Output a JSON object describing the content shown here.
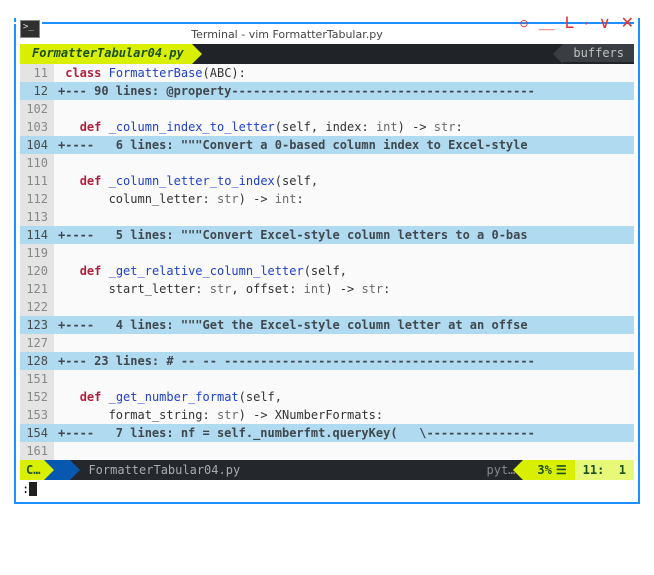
{
  "window": {
    "title": "Terminal - vim FormatterTabular.py"
  },
  "tab": {
    "active": "FormatterTabular04.py",
    "buffers_label": "buffers"
  },
  "code_lines": [
    {
      "num": "11",
      "fold": false,
      "tokens": [
        [
          " ",
          ""
        ],
        [
          "class",
          "kw"
        ],
        [
          " ",
          ""
        ],
        [
          "FormatterBase",
          "cls"
        ],
        [
          "(ABC):",
          "paren"
        ]
      ]
    },
    {
      "num": "12",
      "fold": true,
      "text": "+--- 90 lines: @property------------------------------------------"
    },
    {
      "num": "102",
      "fold": false,
      "tokens": []
    },
    {
      "num": "103",
      "fold": false,
      "tokens": [
        [
          "   ",
          ""
        ],
        [
          "def",
          "kw"
        ],
        [
          " ",
          ""
        ],
        [
          "_column_index_to_letter",
          "fn"
        ],
        [
          "(self, index: ",
          "paren"
        ],
        [
          "int",
          "ann"
        ],
        [
          ") -> ",
          "paren"
        ],
        [
          "str",
          "ann"
        ],
        [
          ":",
          "paren"
        ]
      ]
    },
    {
      "num": "104",
      "fold": true,
      "text": "+----   6 lines: \"\"\"Convert a 0-based column index to Excel-style"
    },
    {
      "num": "110",
      "fold": false,
      "tokens": []
    },
    {
      "num": "111",
      "fold": false,
      "tokens": [
        [
          "   ",
          ""
        ],
        [
          "def",
          "kw"
        ],
        [
          " ",
          ""
        ],
        [
          "_column_letter_to_index",
          "fn"
        ],
        [
          "(self,",
          "paren"
        ]
      ]
    },
    {
      "num": "112",
      "fold": false,
      "tokens": [
        [
          "       column_letter: ",
          "paren"
        ],
        [
          "str",
          "ann"
        ],
        [
          ") -> ",
          "paren"
        ],
        [
          "int",
          "ann"
        ],
        [
          ":",
          "paren"
        ]
      ]
    },
    {
      "num": "113",
      "fold": false,
      "tokens": []
    },
    {
      "num": "114",
      "fold": true,
      "text": "+----   5 lines: \"\"\"Convert Excel-style column letters to a 0-bas"
    },
    {
      "num": "119",
      "fold": false,
      "tokens": []
    },
    {
      "num": "120",
      "fold": false,
      "tokens": [
        [
          "   ",
          ""
        ],
        [
          "def",
          "kw"
        ],
        [
          " ",
          ""
        ],
        [
          "_get_relative_column_letter",
          "fn"
        ],
        [
          "(self,",
          "paren"
        ]
      ]
    },
    {
      "num": "121",
      "fold": false,
      "tokens": [
        [
          "       start_letter: ",
          "paren"
        ],
        [
          "str",
          "ann"
        ],
        [
          ", offset: ",
          "paren"
        ],
        [
          "int",
          "ann"
        ],
        [
          ") -> ",
          "paren"
        ],
        [
          "str",
          "ann"
        ],
        [
          ":",
          "paren"
        ]
      ]
    },
    {
      "num": "122",
      "fold": false,
      "tokens": []
    },
    {
      "num": "123",
      "fold": true,
      "text": "+----   4 lines: \"\"\"Get the Excel-style column letter at an offse"
    },
    {
      "num": "127",
      "fold": false,
      "tokens": []
    },
    {
      "num": "128",
      "fold": true,
      "text": "+--- 23 lines: # -- -- -------------------------------------------"
    },
    {
      "num": "151",
      "fold": false,
      "tokens": []
    },
    {
      "num": "152",
      "fold": false,
      "tokens": [
        [
          "   ",
          ""
        ],
        [
          "def",
          "kw"
        ],
        [
          " ",
          ""
        ],
        [
          "_get_number_format",
          "fn"
        ],
        [
          "(self,",
          "paren"
        ]
      ]
    },
    {
      "num": "153",
      "fold": false,
      "tokens": [
        [
          "       format_string: ",
          "paren"
        ],
        [
          "str",
          "ann"
        ],
        [
          ") -> XNumberFormats:",
          "paren"
        ]
      ]
    },
    {
      "num": "154",
      "fold": true,
      "text": "+----   7 lines: nf = self._numberfmt.queryKey(   \\---------------"
    },
    {
      "num": "161",
      "fold": false,
      "tokens": []
    }
  ],
  "status": {
    "mode": "C…",
    "branch_icon": "",
    "file": "FormatterTabular04.py",
    "filetype": "pyt…",
    "percent": "3%",
    "line": "11",
    "col": "1"
  },
  "cmd_prefix": ":"
}
